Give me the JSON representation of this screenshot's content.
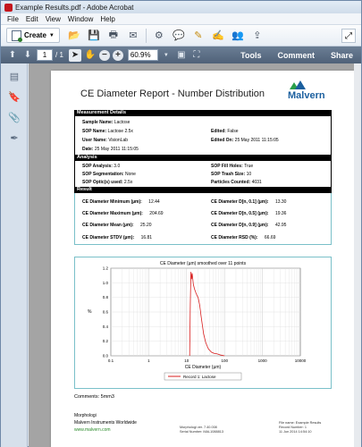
{
  "window": {
    "title": "Example Results.pdf - Adobe Acrobat"
  },
  "menu": [
    "File",
    "Edit",
    "View",
    "Window",
    "Help"
  ],
  "toolbar": {
    "create_label": "Create"
  },
  "nav": {
    "page_current": "1",
    "page_total": "/ 1",
    "zoom": "60.9%"
  },
  "tabs": [
    "Tools",
    "Comment",
    "Share"
  ],
  "report": {
    "title": "CE Diameter Report - Number Distribution",
    "logo_text": "Malvern",
    "sections": {
      "measurement": "Measurement Details",
      "analysis": "Analysis",
      "result": "Result"
    },
    "measurement": {
      "sample_name": [
        "Sample Name:",
        "Lactose"
      ],
      "sop_name": [
        "SOP Name:",
        "Lactose 2.5x"
      ],
      "user_name": [
        "User Name:",
        "VisionLab"
      ],
      "date": [
        "Date:",
        "25 May 2011 11:15:05"
      ],
      "edited": [
        "Edited:",
        "False"
      ],
      "edited_on": [
        "Edited On:",
        "25 May 2011 11:15:05"
      ]
    },
    "analysis": {
      "sop_analysis": [
        "SOP Analysis:",
        "3.0"
      ],
      "sop_segmentation": [
        "SOP Segmentation:",
        "None"
      ],
      "sop_optics": [
        "SOP Optic(s) used:",
        "2.5x"
      ],
      "sop_fill_holes": [
        "SOP Fill Holes:",
        "True"
      ],
      "sop_trash_size": [
        "SOP Trash Size:",
        "10"
      ],
      "particles_counted": [
        "Particles Counted:",
        "4031"
      ]
    },
    "result": {
      "min": [
        "CE Diameter Minimum (µm):",
        "12.44"
      ],
      "max": [
        "CE Diameter Maximum (µm):",
        "204.69"
      ],
      "mean": [
        "CE Diameter Mean (µm):",
        "25.20"
      ],
      "stdv": [
        "CE Diameter STDV (µm):",
        "16.81"
      ],
      "d01": [
        "CE Diameter D[n, 0.1] (µm):",
        "13.30"
      ],
      "d05": [
        "CE Diameter D[n, 0.5] (µm):",
        "19.36"
      ],
      "d09": [
        "CE Diameter D[n, 0.9] (µm):",
        "42.95"
      ],
      "rsd": [
        "CE Diameter RSD (%):",
        "66.69"
      ]
    },
    "comments": "Comments: 5mm3",
    "footer": {
      "line1": "Morphologi",
      "line2": "Malvern Instruments Worldwide",
      "line3": "www.malvern.com",
      "center1": "Morphologi ver. 7.40.008",
      "center2": "Serial Number: MAL1088813",
      "right1": "File name: Example Results",
      "right2": "Record Number: 1",
      "right3": "11 Jun 2014 14:54:10"
    }
  },
  "chart_data": {
    "type": "line",
    "title": "CE Diameter (µm) smoothed over 11 points",
    "xlabel": "CE Diameter (µm)",
    "ylabel": "%",
    "x_scale": "log",
    "xlim": [
      0.1,
      10000
    ],
    "ylim": [
      0,
      1.2
    ],
    "x_ticks": [
      "0.1",
      "1",
      "10",
      "100",
      "1000",
      "10000"
    ],
    "y_ticks": [
      "0.0",
      "0.2",
      "0.4",
      "0.6",
      "0.8",
      "1.0",
      "1.2"
    ],
    "grid": true,
    "legend": "bottom-center",
    "series": [
      {
        "name": "Record 1: Lactose",
        "color": "#d81e1e",
        "x": [
          12,
          12.5,
          13,
          13.5,
          14,
          15,
          16,
          17,
          18,
          19,
          20,
          21,
          22,
          23,
          24,
          25,
          26,
          27,
          28,
          30,
          32,
          35,
          38,
          40,
          45,
          50,
          55,
          60,
          70,
          80,
          100
        ],
        "y": [
          0.0,
          0.7,
          1.15,
          1.05,
          1.13,
          0.98,
          0.92,
          0.88,
          0.85,
          0.82,
          0.8,
          0.75,
          0.7,
          0.63,
          0.55,
          0.48,
          0.42,
          0.36,
          0.3,
          0.24,
          0.18,
          0.13,
          0.09,
          0.08,
          0.05,
          0.04,
          0.03,
          0.03,
          0.02,
          0.01,
          0.0
        ]
      }
    ]
  }
}
